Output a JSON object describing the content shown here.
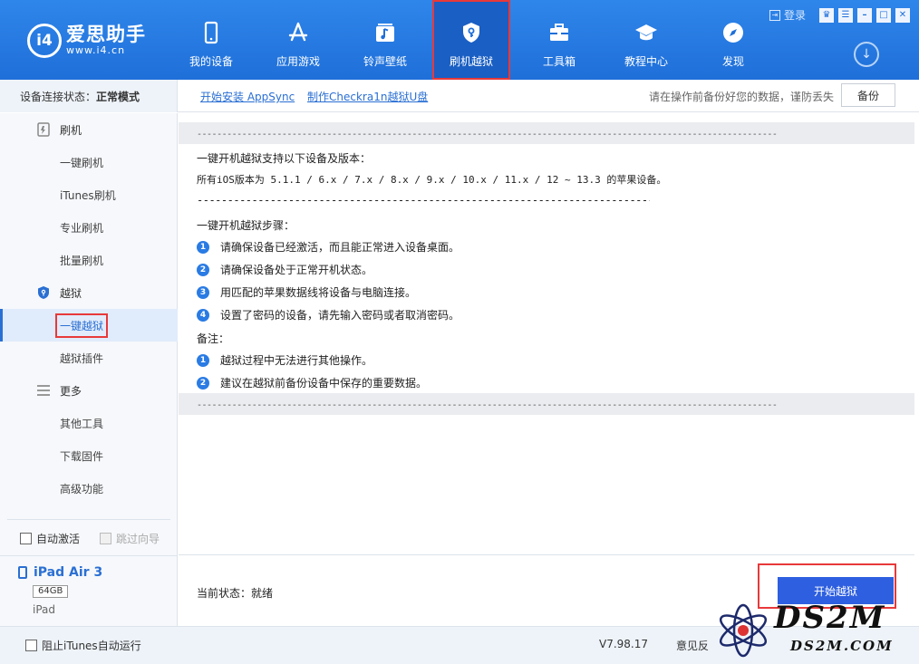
{
  "app": {
    "logo_mark": "i4",
    "logo_name": "爱思助手",
    "logo_url": "www.i4.cn"
  },
  "nav": [
    {
      "label": "我的设备",
      "icon": "phone-icon"
    },
    {
      "label": "应用游戏",
      "icon": "app-store-icon"
    },
    {
      "label": "铃声壁纸",
      "icon": "music-icon"
    },
    {
      "label": "刷机越狱",
      "icon": "shield-key-icon",
      "active": true
    },
    {
      "label": "工具箱",
      "icon": "toolbox-icon"
    },
    {
      "label": "教程中心",
      "icon": "graduation-cap-icon"
    },
    {
      "label": "发现",
      "icon": "compass-icon"
    }
  ],
  "topright": {
    "login": "登录"
  },
  "status": {
    "label": "设备连接状态：",
    "value": "正常模式"
  },
  "toplinks": {
    "appsync": "开始安装 AppSync",
    "checkra1n": "制作Checkra1n越狱U盘"
  },
  "warning": "请在操作前备份好您的数据，谨防丢失",
  "backup_label": "备份",
  "sidebar": {
    "group_flash": "刷机",
    "flash_items": [
      "一键刷机",
      "iTunes刷机",
      "专业刷机",
      "批量刷机"
    ],
    "group_jailbreak": "越狱",
    "jailbreak_items": [
      "一键越狱",
      "越狱插件"
    ],
    "group_more": "更多",
    "more_items": [
      "其他工具",
      "下载固件",
      "高级功能"
    ],
    "auto_activate": "自动激活",
    "skip_guide": "跳过向导"
  },
  "device": {
    "name": "iPad Air 3",
    "capacity": "64GB",
    "type": "iPad"
  },
  "content": {
    "dashes": "--------------------------------------------------------------------------------------------------------------------",
    "support_title": "一键开机越狱支持以下设备及版本：",
    "support_versions": "所有iOS版本为 5.1.1 / 6.x / 7.x / 8.x / 9.x / 10.x / 11.x / 12 ~ 13.3 的苹果设备。",
    "steps_title": "一键开机越狱步骤：",
    "steps": [
      "请确保设备已经激活，而且能正常进入设备桌面。",
      "请确保设备处于正常开机状态。",
      "用匹配的苹果数据线将设备与电脑连接。",
      "设置了密码的设备，请先输入密码或者取消密码。"
    ],
    "notes_title": "备注：",
    "notes": [
      "越狱过程中无法进行其他操作。",
      "建议在越狱前备份设备中保存的重要数据。"
    ],
    "step_numbers": [
      "1",
      "2",
      "3",
      "4"
    ],
    "current_state": "当前状态：就绪",
    "start_button": "开始越狱"
  },
  "footer": {
    "block_itunes": "阻止iTunes自动运行",
    "version": "V7.98.17",
    "feedback": "意见反"
  },
  "watermark": {
    "big": "DS2M",
    "small": "DS2M.COM"
  }
}
